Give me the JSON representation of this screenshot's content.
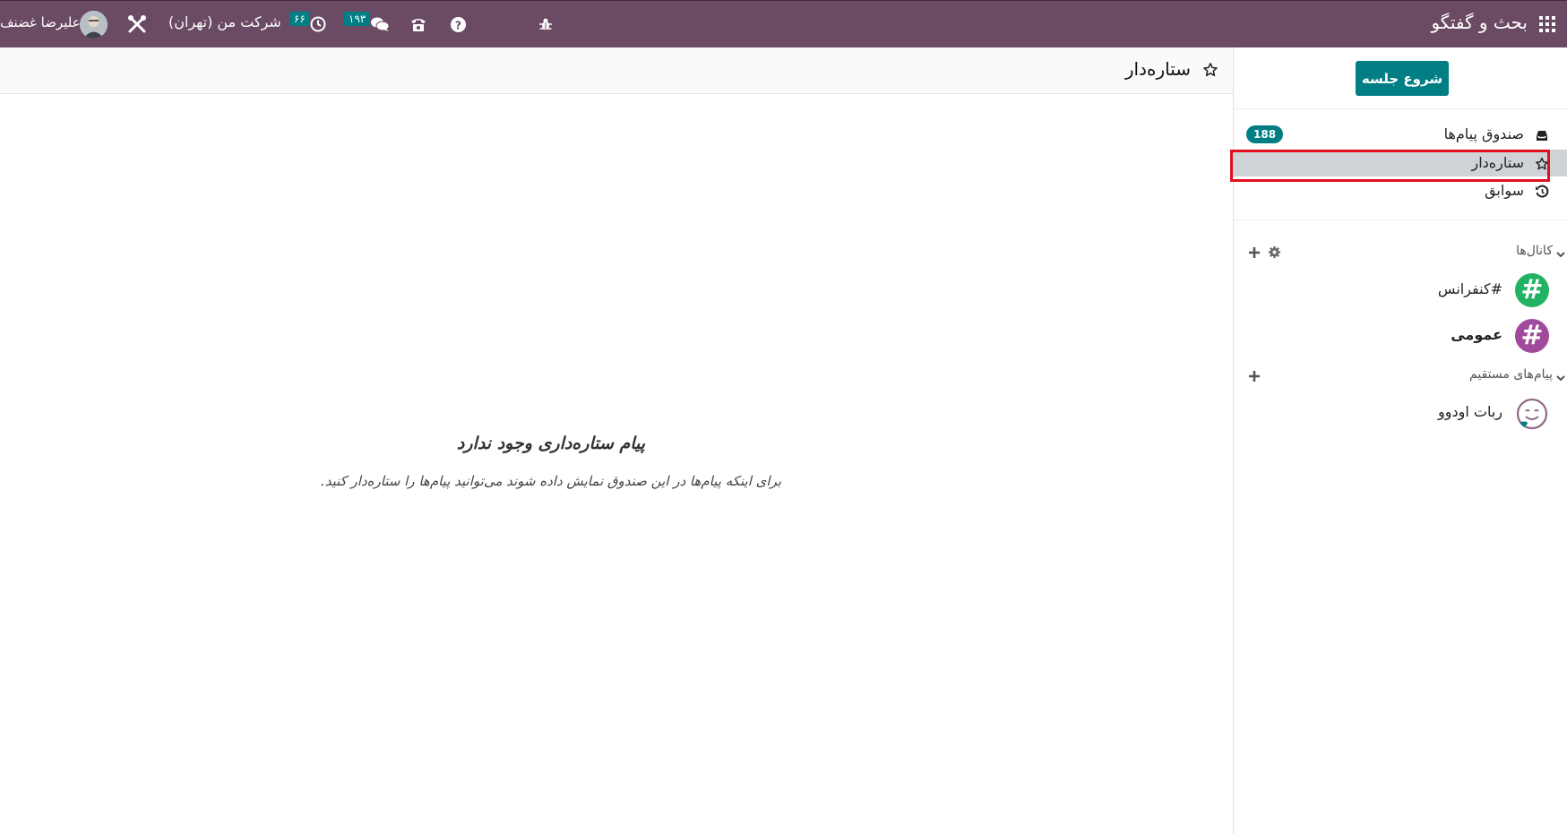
{
  "navbar": {
    "app_title": "بحث و گفتگو",
    "activities_badge": "۶۶",
    "messages_badge": "۱۹۳",
    "company": "شرکت من (تهران)",
    "user_name": "علیرضا غضنف"
  },
  "header": {
    "title": "ستاره‌دار"
  },
  "empty_state": {
    "title": "پیام ستاره‌داری وجود ندارد",
    "subtitle": "برای اینکه پیام‌ها در این صندوق نمایش داده شوند می‌توانید پیام‌ها را ستاره‌دار کنید."
  },
  "sidebar": {
    "start_button": "شروع جلسه",
    "mailboxes": [
      {
        "label": "صندوق پیام‌ها",
        "icon": "inbox-icon",
        "badge": "188"
      },
      {
        "label": "ستاره‌دار",
        "icon": "star-icon",
        "active": true
      },
      {
        "label": "سوابق",
        "icon": "history-icon"
      }
    ],
    "channels_header": "کانال‌ها",
    "channels": [
      {
        "label": "#کنفرانس",
        "color": "#21b363",
        "bold": false
      },
      {
        "label": "عمومی",
        "color": "#a04a9b",
        "bold": true
      }
    ],
    "direct_header": "پیام‌های مستقیم",
    "direct": [
      {
        "label": "ربات اودوو"
      }
    ]
  },
  "colors": {
    "navbar": "#6b4a63",
    "accent": "#017e84",
    "highlight": "#e0101e"
  }
}
